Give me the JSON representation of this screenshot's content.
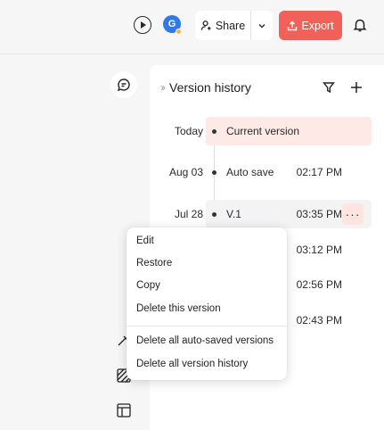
{
  "header": {
    "avatar_letter": "G",
    "share_label": "Share",
    "export_label": "Export",
    "accent_color": "#f2605a",
    "icons": [
      "play-icon",
      "user-icon",
      "chevron-down-icon",
      "export-icon",
      "bell-icon"
    ]
  },
  "sidebar": {
    "icons": [
      "comment-icon",
      "magic-wand-icon",
      "pattern-icon",
      "layout-icon"
    ]
  },
  "panel": {
    "title": "Version history",
    "icons": [
      "double-chevron-right-icon",
      "filter-icon",
      "plus-icon"
    ],
    "versions": [
      {
        "date": "Today",
        "name": "Current version",
        "time": ""
      },
      {
        "date": "Aug 03",
        "name": "Auto save",
        "time": "02:17 PM"
      },
      {
        "date": "Jul 28",
        "name": "V.1",
        "time": "03:35 PM"
      },
      {
        "date": "",
        "name": "",
        "time": "03:12 PM"
      },
      {
        "date": "",
        "name": "",
        "time": "02:56 PM"
      },
      {
        "date": "",
        "name": "",
        "time": "02:43 PM"
      }
    ],
    "more_label": "···",
    "highlight_color": "#fde9e6"
  },
  "context_menu": {
    "items": [
      "Edit",
      "Restore",
      "Copy",
      "Delete this version",
      "Delete all auto-saved versions",
      "Delete all version history"
    ]
  }
}
